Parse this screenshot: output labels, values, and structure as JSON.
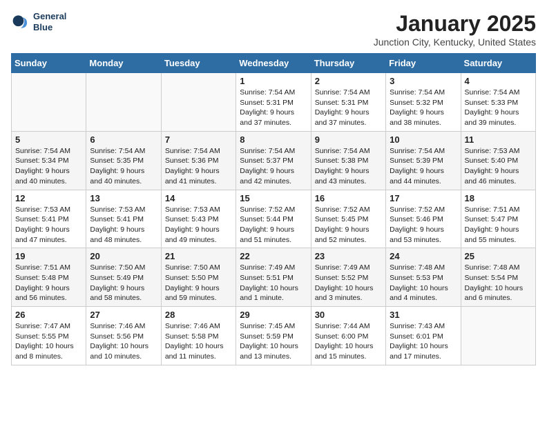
{
  "logo": {
    "line1": "General",
    "line2": "Blue"
  },
  "title": "January 2025",
  "subtitle": "Junction City, Kentucky, United States",
  "header": {
    "days": [
      "Sunday",
      "Monday",
      "Tuesday",
      "Wednesday",
      "Thursday",
      "Friday",
      "Saturday"
    ]
  },
  "weeks": [
    {
      "cells": [
        {
          "day": "",
          "detail": ""
        },
        {
          "day": "",
          "detail": ""
        },
        {
          "day": "",
          "detail": ""
        },
        {
          "day": "1",
          "detail": "Sunrise: 7:54 AM\nSunset: 5:31 PM\nDaylight: 9 hours\nand 37 minutes."
        },
        {
          "day": "2",
          "detail": "Sunrise: 7:54 AM\nSunset: 5:31 PM\nDaylight: 9 hours\nand 37 minutes."
        },
        {
          "day": "3",
          "detail": "Sunrise: 7:54 AM\nSunset: 5:32 PM\nDaylight: 9 hours\nand 38 minutes."
        },
        {
          "day": "4",
          "detail": "Sunrise: 7:54 AM\nSunset: 5:33 PM\nDaylight: 9 hours\nand 39 minutes."
        }
      ]
    },
    {
      "cells": [
        {
          "day": "5",
          "detail": "Sunrise: 7:54 AM\nSunset: 5:34 PM\nDaylight: 9 hours\nand 40 minutes."
        },
        {
          "day": "6",
          "detail": "Sunrise: 7:54 AM\nSunset: 5:35 PM\nDaylight: 9 hours\nand 40 minutes."
        },
        {
          "day": "7",
          "detail": "Sunrise: 7:54 AM\nSunset: 5:36 PM\nDaylight: 9 hours\nand 41 minutes."
        },
        {
          "day": "8",
          "detail": "Sunrise: 7:54 AM\nSunset: 5:37 PM\nDaylight: 9 hours\nand 42 minutes."
        },
        {
          "day": "9",
          "detail": "Sunrise: 7:54 AM\nSunset: 5:38 PM\nDaylight: 9 hours\nand 43 minutes."
        },
        {
          "day": "10",
          "detail": "Sunrise: 7:54 AM\nSunset: 5:39 PM\nDaylight: 9 hours\nand 44 minutes."
        },
        {
          "day": "11",
          "detail": "Sunrise: 7:53 AM\nSunset: 5:40 PM\nDaylight: 9 hours\nand 46 minutes."
        }
      ]
    },
    {
      "cells": [
        {
          "day": "12",
          "detail": "Sunrise: 7:53 AM\nSunset: 5:41 PM\nDaylight: 9 hours\nand 47 minutes."
        },
        {
          "day": "13",
          "detail": "Sunrise: 7:53 AM\nSunset: 5:41 PM\nDaylight: 9 hours\nand 48 minutes."
        },
        {
          "day": "14",
          "detail": "Sunrise: 7:53 AM\nSunset: 5:43 PM\nDaylight: 9 hours\nand 49 minutes."
        },
        {
          "day": "15",
          "detail": "Sunrise: 7:52 AM\nSunset: 5:44 PM\nDaylight: 9 hours\nand 51 minutes."
        },
        {
          "day": "16",
          "detail": "Sunrise: 7:52 AM\nSunset: 5:45 PM\nDaylight: 9 hours\nand 52 minutes."
        },
        {
          "day": "17",
          "detail": "Sunrise: 7:52 AM\nSunset: 5:46 PM\nDaylight: 9 hours\nand 53 minutes."
        },
        {
          "day": "18",
          "detail": "Sunrise: 7:51 AM\nSunset: 5:47 PM\nDaylight: 9 hours\nand 55 minutes."
        }
      ]
    },
    {
      "cells": [
        {
          "day": "19",
          "detail": "Sunrise: 7:51 AM\nSunset: 5:48 PM\nDaylight: 9 hours\nand 56 minutes."
        },
        {
          "day": "20",
          "detail": "Sunrise: 7:50 AM\nSunset: 5:49 PM\nDaylight: 9 hours\nand 58 minutes."
        },
        {
          "day": "21",
          "detail": "Sunrise: 7:50 AM\nSunset: 5:50 PM\nDaylight: 9 hours\nand 59 minutes."
        },
        {
          "day": "22",
          "detail": "Sunrise: 7:49 AM\nSunset: 5:51 PM\nDaylight: 10 hours\nand 1 minute."
        },
        {
          "day": "23",
          "detail": "Sunrise: 7:49 AM\nSunset: 5:52 PM\nDaylight: 10 hours\nand 3 minutes."
        },
        {
          "day": "24",
          "detail": "Sunrise: 7:48 AM\nSunset: 5:53 PM\nDaylight: 10 hours\nand 4 minutes."
        },
        {
          "day": "25",
          "detail": "Sunrise: 7:48 AM\nSunset: 5:54 PM\nDaylight: 10 hours\nand 6 minutes."
        }
      ]
    },
    {
      "cells": [
        {
          "day": "26",
          "detail": "Sunrise: 7:47 AM\nSunset: 5:55 PM\nDaylight: 10 hours\nand 8 minutes."
        },
        {
          "day": "27",
          "detail": "Sunrise: 7:46 AM\nSunset: 5:56 PM\nDaylight: 10 hours\nand 10 minutes."
        },
        {
          "day": "28",
          "detail": "Sunrise: 7:46 AM\nSunset: 5:58 PM\nDaylight: 10 hours\nand 11 minutes."
        },
        {
          "day": "29",
          "detail": "Sunrise: 7:45 AM\nSunset: 5:59 PM\nDaylight: 10 hours\nand 13 minutes."
        },
        {
          "day": "30",
          "detail": "Sunrise: 7:44 AM\nSunset: 6:00 PM\nDaylight: 10 hours\nand 15 minutes."
        },
        {
          "day": "31",
          "detail": "Sunrise: 7:43 AM\nSunset: 6:01 PM\nDaylight: 10 hours\nand 17 minutes."
        },
        {
          "day": "",
          "detail": ""
        }
      ]
    }
  ]
}
